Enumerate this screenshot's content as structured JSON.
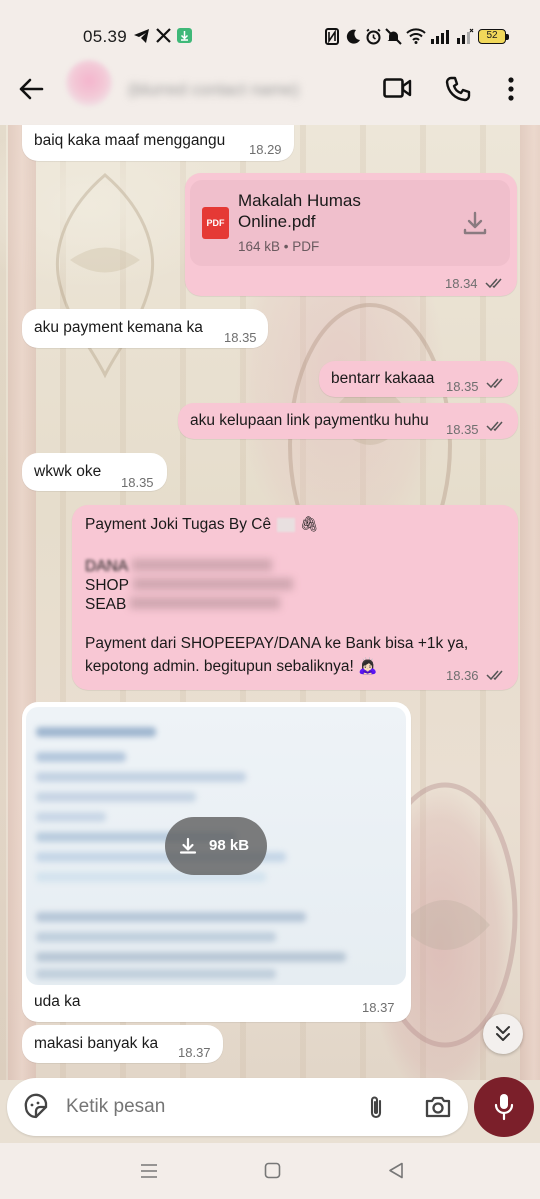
{
  "status_bar": {
    "time": "05.39",
    "battery": "52",
    "icons": [
      "telegram-icon",
      "x-icon",
      "download-app-icon",
      "nfc-icon",
      "moon-icon",
      "alarm-icon",
      "mute-icon",
      "wifi-icon",
      "signal-icon"
    ]
  },
  "header": {
    "contact_name": "(blurred contact name)",
    "icons": [
      "back-arrow-icon",
      "video-call-icon",
      "voice-call-icon",
      "more-icon"
    ]
  },
  "messages": [
    {
      "dir": "in",
      "text": "baiq kaka maaf menggangu",
      "time": "18.29"
    },
    {
      "dir": "out",
      "type": "document",
      "file_name_line1": "Makalah Humas",
      "file_name_line2": "Online.pdf",
      "file_meta": "164 kB • PDF",
      "file_icon_label": "PDF",
      "time": "18.34"
    },
    {
      "dir": "in",
      "text": "aku payment kemana ka",
      "time": "18.35"
    },
    {
      "dir": "out",
      "text": "bentarr kakaaa",
      "time": "18.35"
    },
    {
      "dir": "out",
      "text": "aku kelupaan link paymentku huhu",
      "time": "18.35"
    },
    {
      "dir": "in",
      "text": "wkwk oke",
      "time": "18.35"
    },
    {
      "dir": "out",
      "type": "payment",
      "line1": "Payment Joki Tugas By Cê",
      "line2": "DANA",
      "line3": "SHOP",
      "line4": "SEAB",
      "line5": "Payment dari SHOPEEPAY/DANA ke Bank bisa +1k ya,",
      "line6": "kepotong admin. begitupun sebaliknya! 🙇🏻‍♀️",
      "time": "18.36"
    },
    {
      "dir": "in",
      "type": "image",
      "download_size": "98 kB",
      "caption": "uda ka",
      "time": "18.37"
    },
    {
      "dir": "in",
      "text": "makasi banyak ka",
      "time": "18.37"
    }
  ],
  "composer": {
    "placeholder": "Ketik pesan"
  },
  "colors": {
    "outgoing_bubble": "#f8c7d4",
    "incoming_bubble": "#ffffff",
    "mic_button": "#7b1f2a"
  }
}
